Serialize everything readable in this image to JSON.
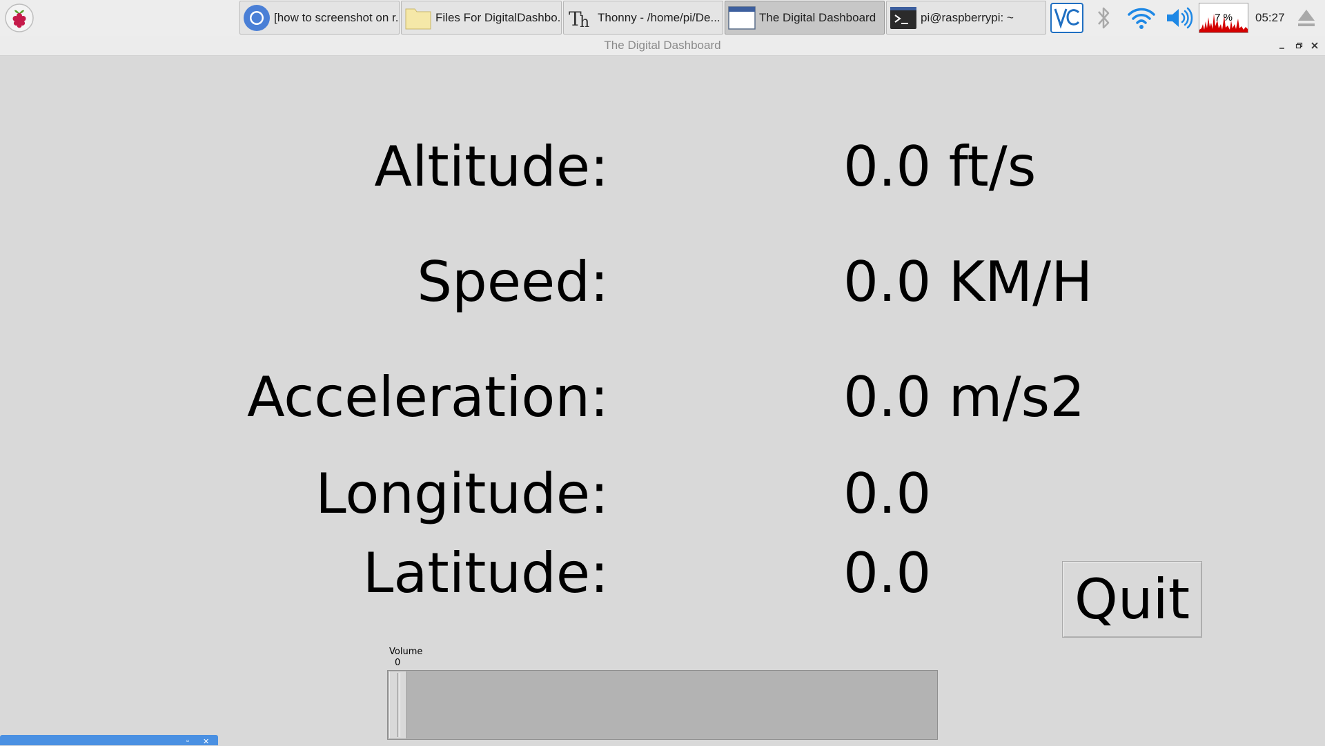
{
  "taskbar": {
    "tasks": [
      {
        "label": "[how to screenshot on r...",
        "icon": "chromium-icon"
      },
      {
        "label": "Files For DigitalDashbo...",
        "icon": "folder-icon"
      },
      {
        "label": "Thonny  -  /home/pi/De...",
        "icon": "thonny-icon"
      },
      {
        "label": "The Digital Dashboard",
        "icon": "window-icon"
      },
      {
        "label": "pi@raspberrypi: ~",
        "icon": "terminal-icon"
      }
    ],
    "tray": {
      "cpu_percent": "7 %",
      "clock": "05:27"
    }
  },
  "window": {
    "title": "The Digital Dashboard"
  },
  "dashboard": {
    "altitude_label": "Altitude:",
    "altitude_value": "0.0 ft/s",
    "speed_label": "Speed:",
    "speed_value": "0.0 KM/H",
    "acceleration_label": "Acceleration:",
    "acceleration_value": "0.0 m/s2",
    "longitude_label": "Longitude:",
    "longitude_value": "0.0",
    "latitude_label": "Latitude:",
    "latitude_value": "0.0",
    "quit_label": "Quit"
  },
  "volume": {
    "label": "Volume",
    "value": "0",
    "level": 0
  },
  "colors": {
    "background": "#d9d9d9",
    "accent_blue": "#4a90e2",
    "cpu_graph": "#d40000"
  }
}
